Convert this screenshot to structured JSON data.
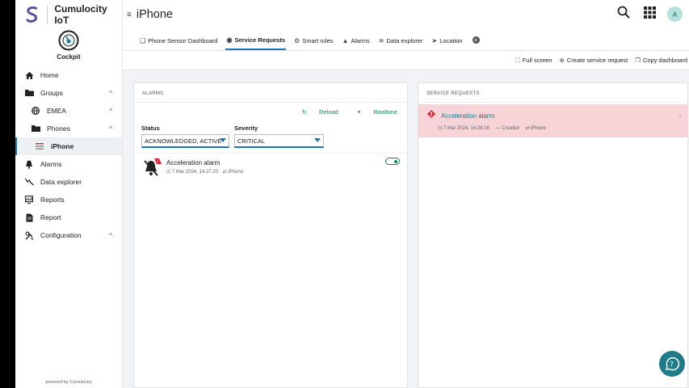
{
  "app": {
    "name": "Cumulocity IoT",
    "module": "Cockpit",
    "powered_by": "powered by Cumulocity"
  },
  "sidebar": {
    "items": [
      {
        "label": "Home",
        "icon": "home-icon"
      },
      {
        "label": "Groups",
        "icon": "folder-icon",
        "chevron": "^"
      },
      {
        "label": "EMEA",
        "icon": "globe-icon",
        "chevron": "^"
      },
      {
        "label": "Phones",
        "icon": "folder-icon",
        "chevron": "^"
      },
      {
        "label": "iPhone",
        "icon": "device-icon"
      },
      {
        "label": "Alarms",
        "icon": "bell-icon"
      },
      {
        "label": "Data explorer",
        "icon": "data-explorer-icon"
      },
      {
        "label": "Reports",
        "icon": "reports-icon"
      },
      {
        "label": "Report",
        "icon": "report-icon"
      },
      {
        "label": "Configuration",
        "icon": "configuration-icon",
        "chevron": "^"
      }
    ]
  },
  "header": {
    "title": "iPhone",
    "avatar": "A"
  },
  "tabs": [
    {
      "label": "Phone Sensor Dashboard",
      "icon": "dashboard-icon"
    },
    {
      "label": "Service Requests",
      "icon": "service-icon"
    },
    {
      "label": "Smart rules",
      "icon": "smart-rules-icon"
    },
    {
      "label": "Alarms",
      "icon": "bell-icon"
    },
    {
      "label": "Data explorer",
      "icon": "data-explorer-icon"
    },
    {
      "label": "Location",
      "icon": "location-icon"
    }
  ],
  "actions": {
    "fullscreen": "Full screen",
    "create": "Create service request",
    "copy": "Copy dashboard"
  },
  "alarms_widget": {
    "title": "ALARMS",
    "reload": "Reload",
    "realtime": "Realtime",
    "status_label": "Status",
    "status_value": "ACKNOWLEDGED, ACTIVE",
    "severity_label": "Severity",
    "severity_value": "CRITICAL",
    "alarm": {
      "text": "Acceleration alarm",
      "time": "7 Mar 2024, 14:27:20",
      "device": "iPhone"
    }
  },
  "service_requests_widget": {
    "title": "SERVICE REQUESTS",
    "item": {
      "title": "Acceleration alarm",
      "time": "7 Mar 2024, 14:28:16",
      "status": "Created",
      "device": "iPhone"
    }
  },
  "colors": {
    "accent": "#1776bf",
    "realtime": "#0d8a57",
    "critical": "#d62839",
    "help": "#1f7a8a"
  }
}
